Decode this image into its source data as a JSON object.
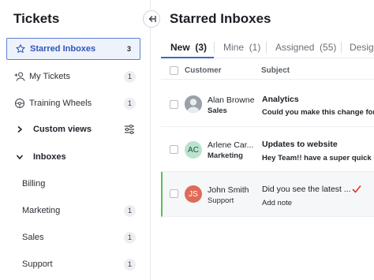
{
  "sidebar": {
    "title": "Tickets",
    "items": [
      {
        "label": "Starred Inboxes",
        "count": "3"
      },
      {
        "label": "My Tickets",
        "count": "1"
      },
      {
        "label": "Training Wheels",
        "count": "1"
      },
      {
        "label": "Custom views"
      },
      {
        "label": "Inboxes"
      },
      {
        "label": "Billing"
      },
      {
        "label": "Marketing",
        "count": "1"
      },
      {
        "label": "Sales",
        "count": "1"
      },
      {
        "label": "Support",
        "count": "1"
      }
    ]
  },
  "main": {
    "title": "Starred Inboxes",
    "tabs": [
      {
        "label": "New",
        "count": "(3)"
      },
      {
        "label": "Mine",
        "count": "(1)"
      },
      {
        "label": "Assigned",
        "count": "(55)"
      },
      {
        "label": "Design"
      }
    ],
    "columns": {
      "customer": "Customer",
      "subject": "Subject"
    },
    "rows": [
      {
        "initials": "",
        "name": "Alan Browne",
        "team": "Sales",
        "subject": "Analytics",
        "preview": "Could you make this change for"
      },
      {
        "initials": "AC",
        "name": "Arlene Car...",
        "team": "Marketing",
        "subject": "Updates to website",
        "preview": "Hey Team!! have a super quick u"
      },
      {
        "initials": "JS",
        "name": "John Smith",
        "team": "Support",
        "subject": "Did you see the latest ...",
        "preview": "Add note"
      }
    ]
  },
  "colors": {
    "accent": "#3b67c9",
    "active_bg": "#eef2fb",
    "highlight_border": "#56c158",
    "check": "#d93b3b"
  }
}
